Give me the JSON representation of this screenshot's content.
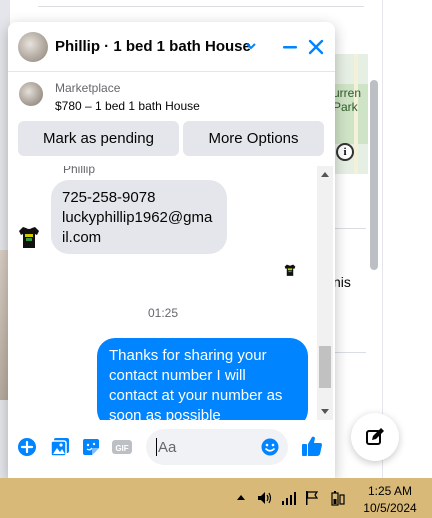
{
  "background": {
    "map_label": "urren\nPark",
    "partial_text": "nis",
    "info_icon": "info-icon"
  },
  "chat": {
    "title": "Phillip · 1 bed 1 bath House",
    "listing": {
      "source": "Marketplace",
      "title": "$780 – 1 bed 1 bath House"
    },
    "actions": {
      "mark_pending": "Mark as pending",
      "more_options": "More Options"
    },
    "messages": {
      "sender_name": "Phillip",
      "incoming_lines": [
        "725-258-9078",
        "luckyphillip1962@gma",
        "il.com"
      ],
      "timestamp": "01:25",
      "outgoing_text": "Thanks for sharing your contact number I will contact at your number as soon as possible"
    },
    "composer": {
      "placeholder": "Aa",
      "icons": [
        "plus-circle-icon",
        "photo-icon",
        "sticker-icon",
        "gif-icon",
        "emoji-icon",
        "thumbs-up-icon"
      ]
    }
  },
  "taskbar": {
    "time": "1:25 AM",
    "date": "10/5/2024"
  },
  "colors": {
    "accent": "#0084ff",
    "taskbar": "#d8b978",
    "bubble_in": "#e4e6eb"
  }
}
